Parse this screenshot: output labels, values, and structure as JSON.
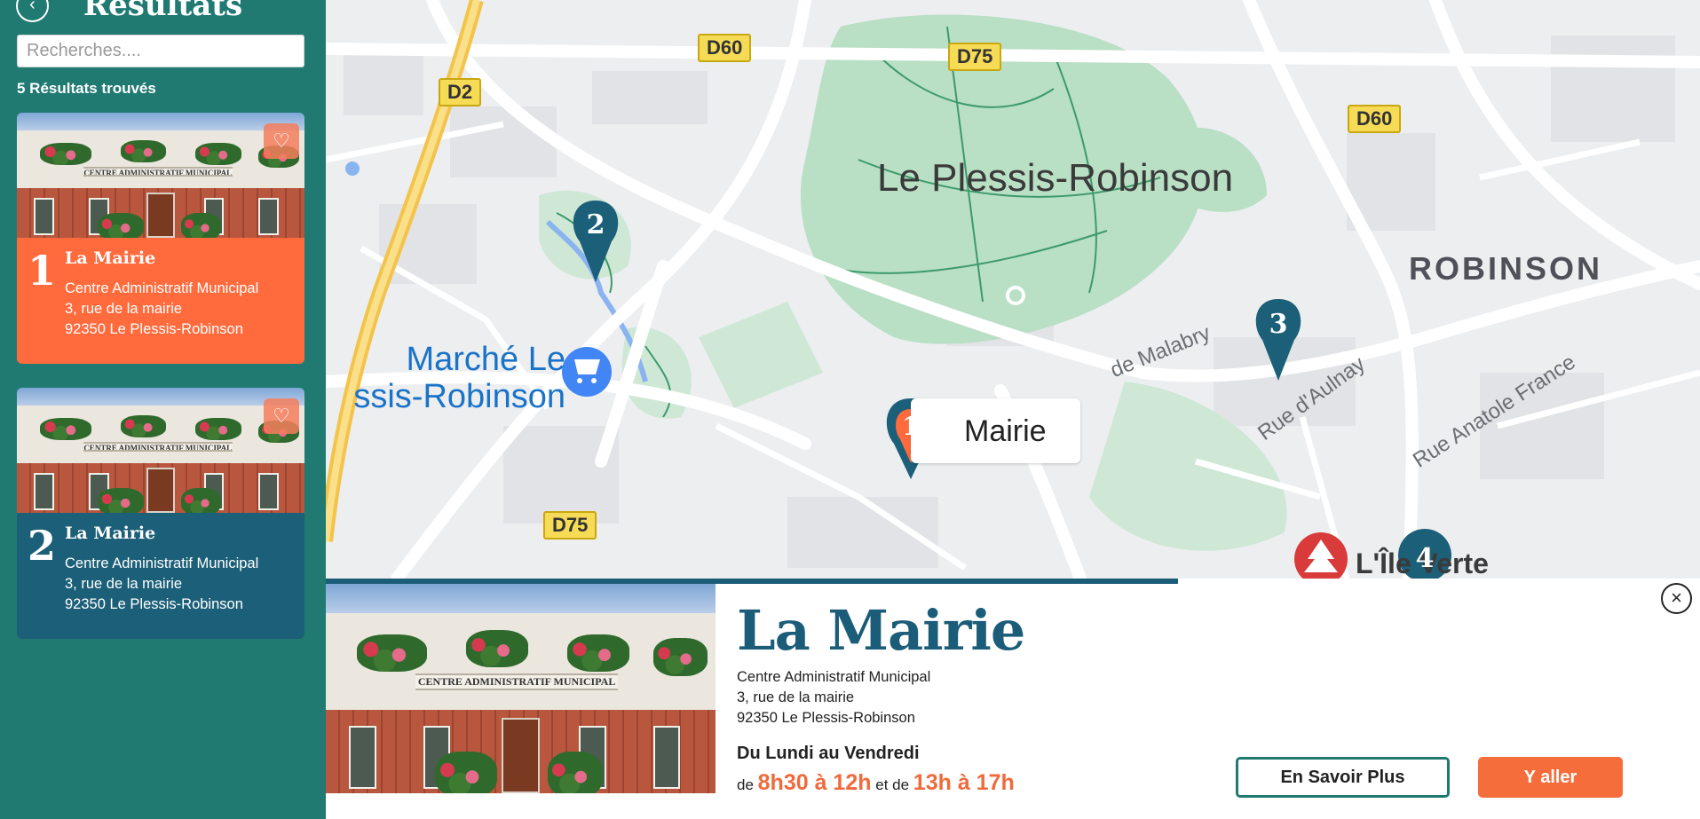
{
  "sidebar": {
    "back_icon": "chevron-left-icon",
    "title": "Résultats",
    "search_placeholder": "Recherches....",
    "results_count": "5 Résultats trouvés",
    "cards": [
      {
        "number": "1",
        "name": "La Mairie",
        "line1": "Centre Administratif Municipal",
        "line2": "3, rue de la mairie",
        "line3": "92350 Le Plessis-Robinson",
        "color": "#ff6b3d",
        "fav_icon": "heart-icon"
      },
      {
        "number": "2",
        "name": "La Mairie",
        "line1": "Centre Administratif Municipal",
        "line2": "3, rue de la mairie",
        "line3": "92350 Le Plessis-Robinson",
        "color": "#1c5f78",
        "fav_icon": "heart-icon"
      }
    ],
    "photo_sign": "CENTRE ADMINISTRATIF MUNICIPAL"
  },
  "map": {
    "city": "Le Plessis-Robinson",
    "district": "ROBINSON",
    "poi": {
      "line1": "Marché Le",
      "line2": "ssis-Robinson"
    },
    "roads": [
      "D60",
      "D75",
      "D2",
      "D60",
      "D75"
    ],
    "streets": [
      "de Malabry",
      "Rue d'Aulnay",
      "Rue Anatole France",
      "L'Île Verte"
    ],
    "selected_label": "Mairie",
    "pins": [
      "1",
      "2",
      "3",
      "4"
    ]
  },
  "detail": {
    "progress": 0.62,
    "title": "La Mairie",
    "line1": "Centre Administratif Municipal",
    "line2": "3, rue de la mairie",
    "line3": "92350 Le Plessis-Robinson",
    "days": "Du Lundi au Vendredi",
    "hours_de1": "de",
    "hours_range1": "8h30 à 12h",
    "hours_et": "et de",
    "hours_range2": "13h à 17h",
    "more_label": "En Savoir Plus",
    "go_label": "Y aller",
    "close_icon": "close-icon",
    "photo_sign": "CENTRE ADMINISTRATIF MUNICIPAL"
  },
  "colors": {
    "sidebar": "#207a72",
    "accent": "#f66d3c",
    "title": "#1b5c79",
    "pin_teal": "#1c5f78",
    "pin_orange": "#ff6b3d"
  }
}
